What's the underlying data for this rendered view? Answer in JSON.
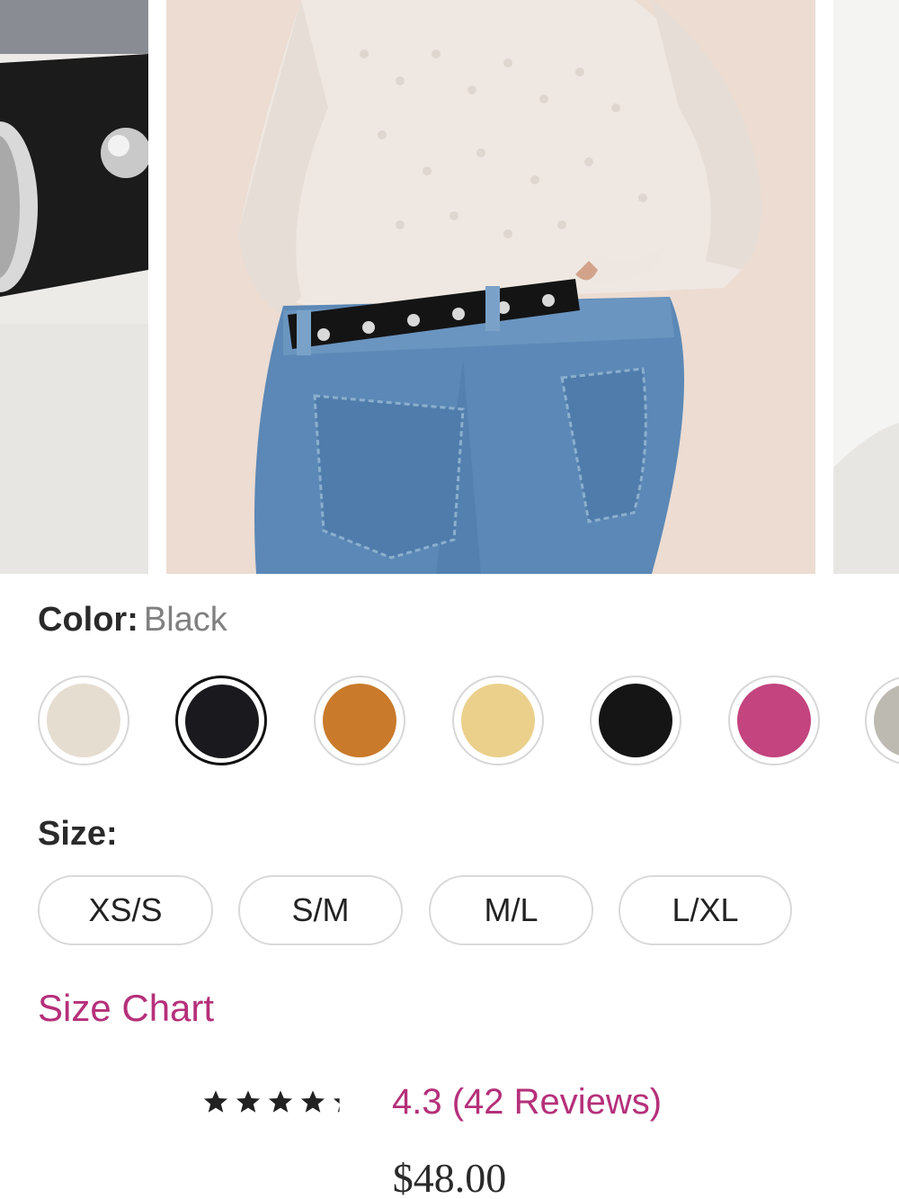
{
  "color": {
    "label": "Color:",
    "selected_value": "Black",
    "swatches": [
      {
        "name": "Ivory",
        "hex": "#e6ddd1",
        "selected": false
      },
      {
        "name": "Black",
        "hex": "#1a1a1e",
        "selected": true
      },
      {
        "name": "Tan",
        "hex": "#c97a2a",
        "selected": false
      },
      {
        "name": "Butter",
        "hex": "#ebd08c",
        "selected": false
      },
      {
        "name": "Black Suede",
        "hex": "#151515",
        "selected": false
      },
      {
        "name": "Pink",
        "hex": "#c3447e",
        "selected": false
      },
      {
        "name": "Grey",
        "hex": "#bdbab2",
        "selected": false
      }
    ]
  },
  "size": {
    "label": "Size:",
    "options": [
      "XS/S",
      "S/M",
      "M/L",
      "L/XL"
    ]
  },
  "size_chart_link": "Size Chart",
  "rating": {
    "stars": 4.3,
    "reviews_text": "4.3 (42 Reviews)"
  },
  "price": "$48.00",
  "accent_color": "#b5307a"
}
